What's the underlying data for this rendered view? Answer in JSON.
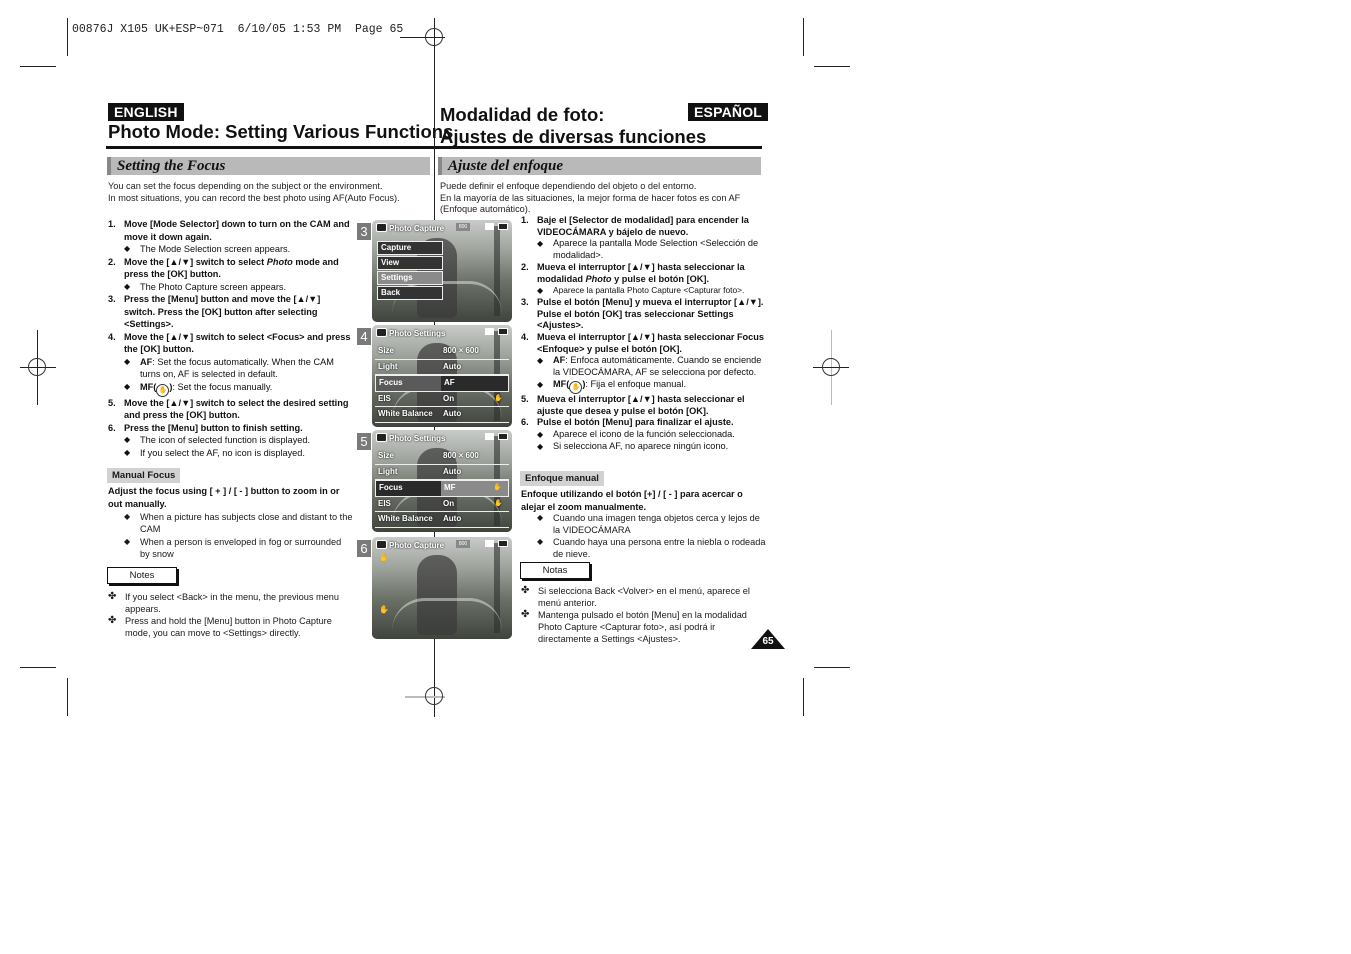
{
  "slug": "00876J X105 UK+ESP~071  6/10/05 1:53 PM  Page 65",
  "english": {
    "badge": "ENGLISH",
    "title": "Photo Mode: Setting Various Functions",
    "section": "Setting the Focus",
    "intro": [
      "You can set the focus depending on the subject or the environment.",
      "In most situations, you can record the best photo using AF(Auto Focus)."
    ],
    "steps": [
      {
        "num": "1.",
        "text": "Move [Mode Selector] down to turn on the CAM and move it down again.",
        "bullets": [
          "The Mode Selection screen appears."
        ]
      },
      {
        "num": "2.",
        "text_a": "Move the [▲/▼] switch to select ",
        "text_em": "Photo",
        "text_b": " mode and press the [OK] button.",
        "bullets": [
          "The Photo Capture screen appears."
        ]
      },
      {
        "num": "3.",
        "text": "Press the [Menu] button and move the [▲/▼] switch. Press the [OK] button after selecting <Settings>.",
        "bullets": []
      },
      {
        "num": "4.",
        "text": "Move the [▲/▼] switch to select <Focus> and press the [OK] button.",
        "bullets_rich": [
          {
            "term": "AF",
            "text": ": Set the focus automatically. When the CAM turns on, AF is selected in default."
          },
          {
            "term": "MF(",
            "icon": "manual-focus-hand-icon",
            "term_end": ")",
            "text": ": Set the focus manually."
          }
        ]
      },
      {
        "num": "5.",
        "text": "Move the [▲/▼] switch to select the desired setting and press the [OK] button.",
        "bullets": []
      },
      {
        "num": "6.",
        "text": "Press the [Menu] button to finish setting.",
        "bullets": [
          "The icon of selected function is displayed.",
          "If you select the AF, no icon is displayed."
        ]
      }
    ],
    "manual_focus": {
      "label": "Manual Focus",
      "lead": "Adjust the focus using [ + ] / [ - ] button to zoom in or out manually.",
      "bullets": [
        "When a picture has subjects close and distant to the CAM",
        "When a person is enveloped in fog or surrounded by snow"
      ]
    },
    "notes": {
      "label": "Notes",
      "items": [
        "If you select <Back> in the menu, the previous menu appears.",
        "Press and hold the [Menu] button in Photo Capture mode, you can move to <Settings> directly."
      ]
    }
  },
  "espanol": {
    "badge": "ESPAÑOL",
    "title_line1": "Modalidad de foto:",
    "title_line2": "Ajustes de diversas funciones",
    "section": "Ajuste del enfoque",
    "intro": [
      "Puede definir el enfoque dependiendo del objeto o del entorno.",
      "En la mayoría de las situaciones, la mejor forma de hacer fotos es con AF (Enfoque automático)."
    ],
    "steps": [
      {
        "num": "1.",
        "text": "Baje el [Selector de modalidad] para encender la VIDEOCÁMARA y bájelo de nuevo.",
        "bullets": [
          "Aparece la pantalla Mode Selection <Selección de modalidad>."
        ]
      },
      {
        "num": "2.",
        "text_a": "Mueva el interruptor [▲/▼] hasta seleccionar la modalidad ",
        "text_em": "Photo",
        "text_b": " y pulse el botón [OK].",
        "bullets": [
          "Aparece la pantalla Photo Capture <Capturar foto>."
        ]
      },
      {
        "num": "3.",
        "text": "Pulse el botón [Menu] y mueva el interruptor [▲/▼]. Pulse el botón [OK] tras seleccionar Settings <Ajustes>.",
        "bullets": []
      },
      {
        "num": "4.",
        "text": "Mueva el interruptor [▲/▼] hasta seleccionar Focus <Enfoque> y pulse el botón [OK].",
        "bullets_rich": [
          {
            "term": "AF",
            "text": ": Enfoca automáticamente. Cuando se enciende la VIDEOCÁMARA, AF se selecciona por defecto."
          },
          {
            "term": "MF(",
            "icon": "manual-focus-hand-icon",
            "term_end": ")",
            "text": ": Fija el enfoque manual."
          }
        ]
      },
      {
        "num": "5.",
        "text": "Mueva el interruptor [▲/▼] hasta seleccionar el ajuste que desea y pulse el botón [OK].",
        "bullets": []
      },
      {
        "num": "6.",
        "text": "Pulse el botón [Menu] para finalizar el ajuste.",
        "bullets": [
          "Aparece el icono de la función seleccionada.",
          "Si selecciona AF, no aparece ningún icono."
        ]
      }
    ],
    "manual_focus": {
      "label": "Enfoque manual",
      "lead": "Enfoque utilizando el botón [+] / [ - ] para acercar o alejar el zoom manualmente.",
      "bullets": [
        "Cuando una imagen tenga objetos cerca y lejos de la VIDEOCÁMARA",
        "Cuando haya una persona entre la niebla o rodeada de nieve."
      ]
    },
    "notes": {
      "label": "Notas",
      "items": [
        "Si selecciona Back <Volver> en el menú, aparece el menú anterior.",
        "Mantenga pulsado el botón [Menu] en la modalidad Photo Capture <Capturar foto>, así podrá ir directamente a Settings <Ajustes>."
      ]
    }
  },
  "screens": {
    "s3": {
      "step": "3",
      "title": "Photo Capture",
      "res": "800",
      "menu": [
        "Capture",
        "View",
        "Settings",
        "Back"
      ],
      "selected": "Settings"
    },
    "s4": {
      "step": "4",
      "title": "Photo Settings",
      "rows": [
        {
          "label": "Size",
          "value": "800 × 600"
        },
        {
          "label": "Light",
          "value": "Auto"
        },
        {
          "label": "Focus",
          "value": "AF"
        },
        {
          "label": "EIS",
          "value": "On"
        },
        {
          "label": "White Balance",
          "value": "Auto"
        }
      ],
      "selected": "Focus"
    },
    "s5": {
      "step": "5",
      "title": "Photo Settings",
      "rows": [
        {
          "label": "Size",
          "value": "800 × 600"
        },
        {
          "label": "Light",
          "value": "Auto"
        },
        {
          "label": "Focus",
          "value": "MF"
        },
        {
          "label": "EIS",
          "value": "On"
        },
        {
          "label": "White Balance",
          "value": "Auto"
        }
      ],
      "selected": "Focus"
    },
    "s6": {
      "step": "6",
      "title": "Photo Capture",
      "res": "800"
    }
  },
  "page_number": "65"
}
